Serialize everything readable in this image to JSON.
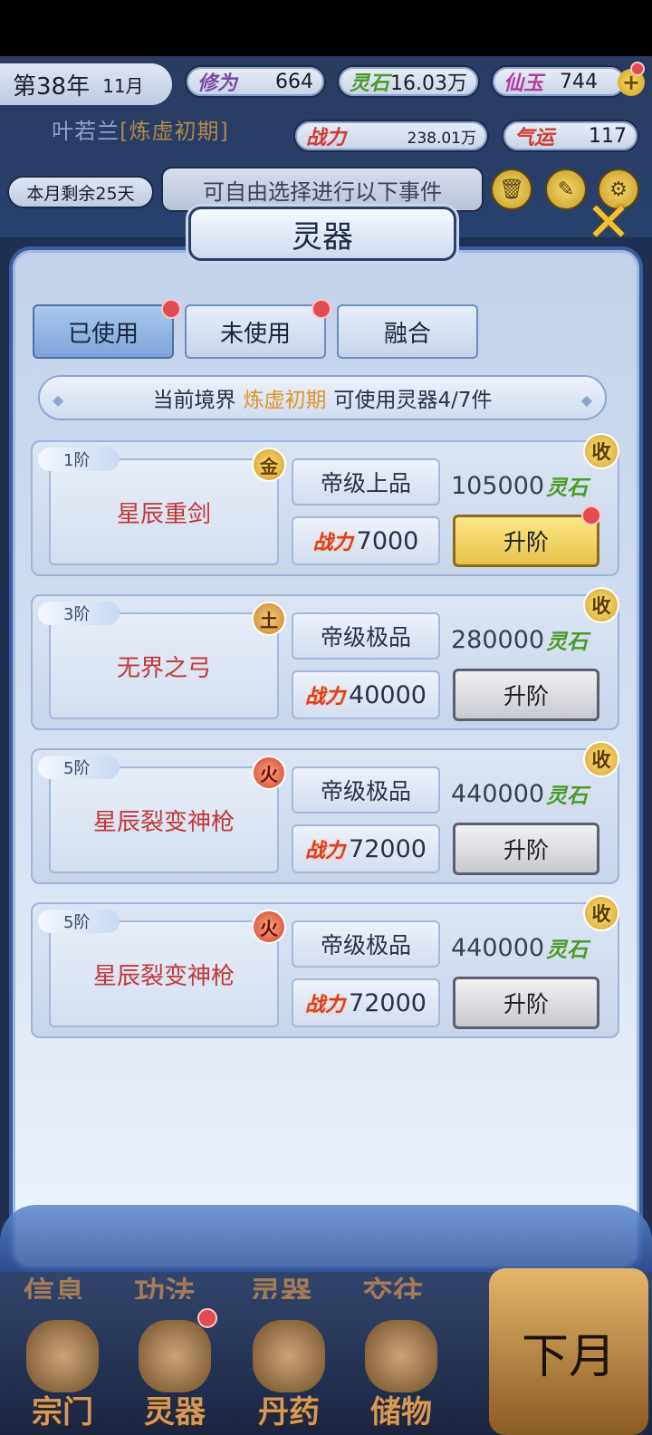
{
  "hud": {
    "year": "第38年",
    "month": "11月",
    "cultivation_label": "修为",
    "cultivation_value": "664",
    "spirit_stone_label": "灵石",
    "spirit_stone_value": "16.03万",
    "jade_label": "仙玉",
    "jade_value": "744",
    "player_name": "叶若兰",
    "player_realm": "炼虚初期",
    "combat_label": "战力",
    "combat_value": "238.01万",
    "luck_label": "气运",
    "luck_value": "117",
    "days_left": "本月剩余25天",
    "event_tip": "可自由选择进行以下事件"
  },
  "panel": {
    "title": "灵器",
    "tabs": [
      {
        "label": "已使用"
      },
      {
        "label": "未使用"
      },
      {
        "label": "融合"
      }
    ],
    "realm_prefix": "当前境界",
    "realm_value": "炼虚初期",
    "realm_suffix": "可使用灵器4/7件"
  },
  "items": [
    {
      "tier": "1阶",
      "element": "金",
      "name": "星辰重剑",
      "grade": "帝级上品",
      "power_label": "战力",
      "power": "7000",
      "cost": "105000",
      "cost_unit": "灵石",
      "upgrade": "升阶",
      "collect": "收"
    },
    {
      "tier": "3阶",
      "element": "土",
      "name": "无界之弓",
      "grade": "帝级极品",
      "power_label": "战力",
      "power": "40000",
      "cost": "280000",
      "cost_unit": "灵石",
      "upgrade": "升阶",
      "collect": "收"
    },
    {
      "tier": "5阶",
      "element": "火",
      "name": "星辰裂变神枪",
      "grade": "帝级极品",
      "power_label": "战力",
      "power": "72000",
      "cost": "440000",
      "cost_unit": "灵石",
      "upgrade": "升阶",
      "collect": "收"
    },
    {
      "tier": "5阶",
      "element": "火",
      "name": "星辰裂变神枪",
      "grade": "帝级极品",
      "power_label": "战力",
      "power": "72000",
      "cost": "440000",
      "cost_unit": "灵石",
      "upgrade": "升阶",
      "collect": "收"
    }
  ],
  "nav": {
    "ghost_labels": [
      "信息",
      "功法",
      "灵器",
      "交往"
    ],
    "items": [
      {
        "label": "宗门"
      },
      {
        "label": "灵器"
      },
      {
        "label": "丹药"
      },
      {
        "label": "储物"
      }
    ],
    "next_month": "下月"
  },
  "colors": {
    "accent_gold": "#f2c030",
    "item_name_red": "#c2373a",
    "realm_orange": "#e0942a",
    "spirit_stone_green": "#4b9b2a",
    "notify_red": "#e24b50"
  }
}
